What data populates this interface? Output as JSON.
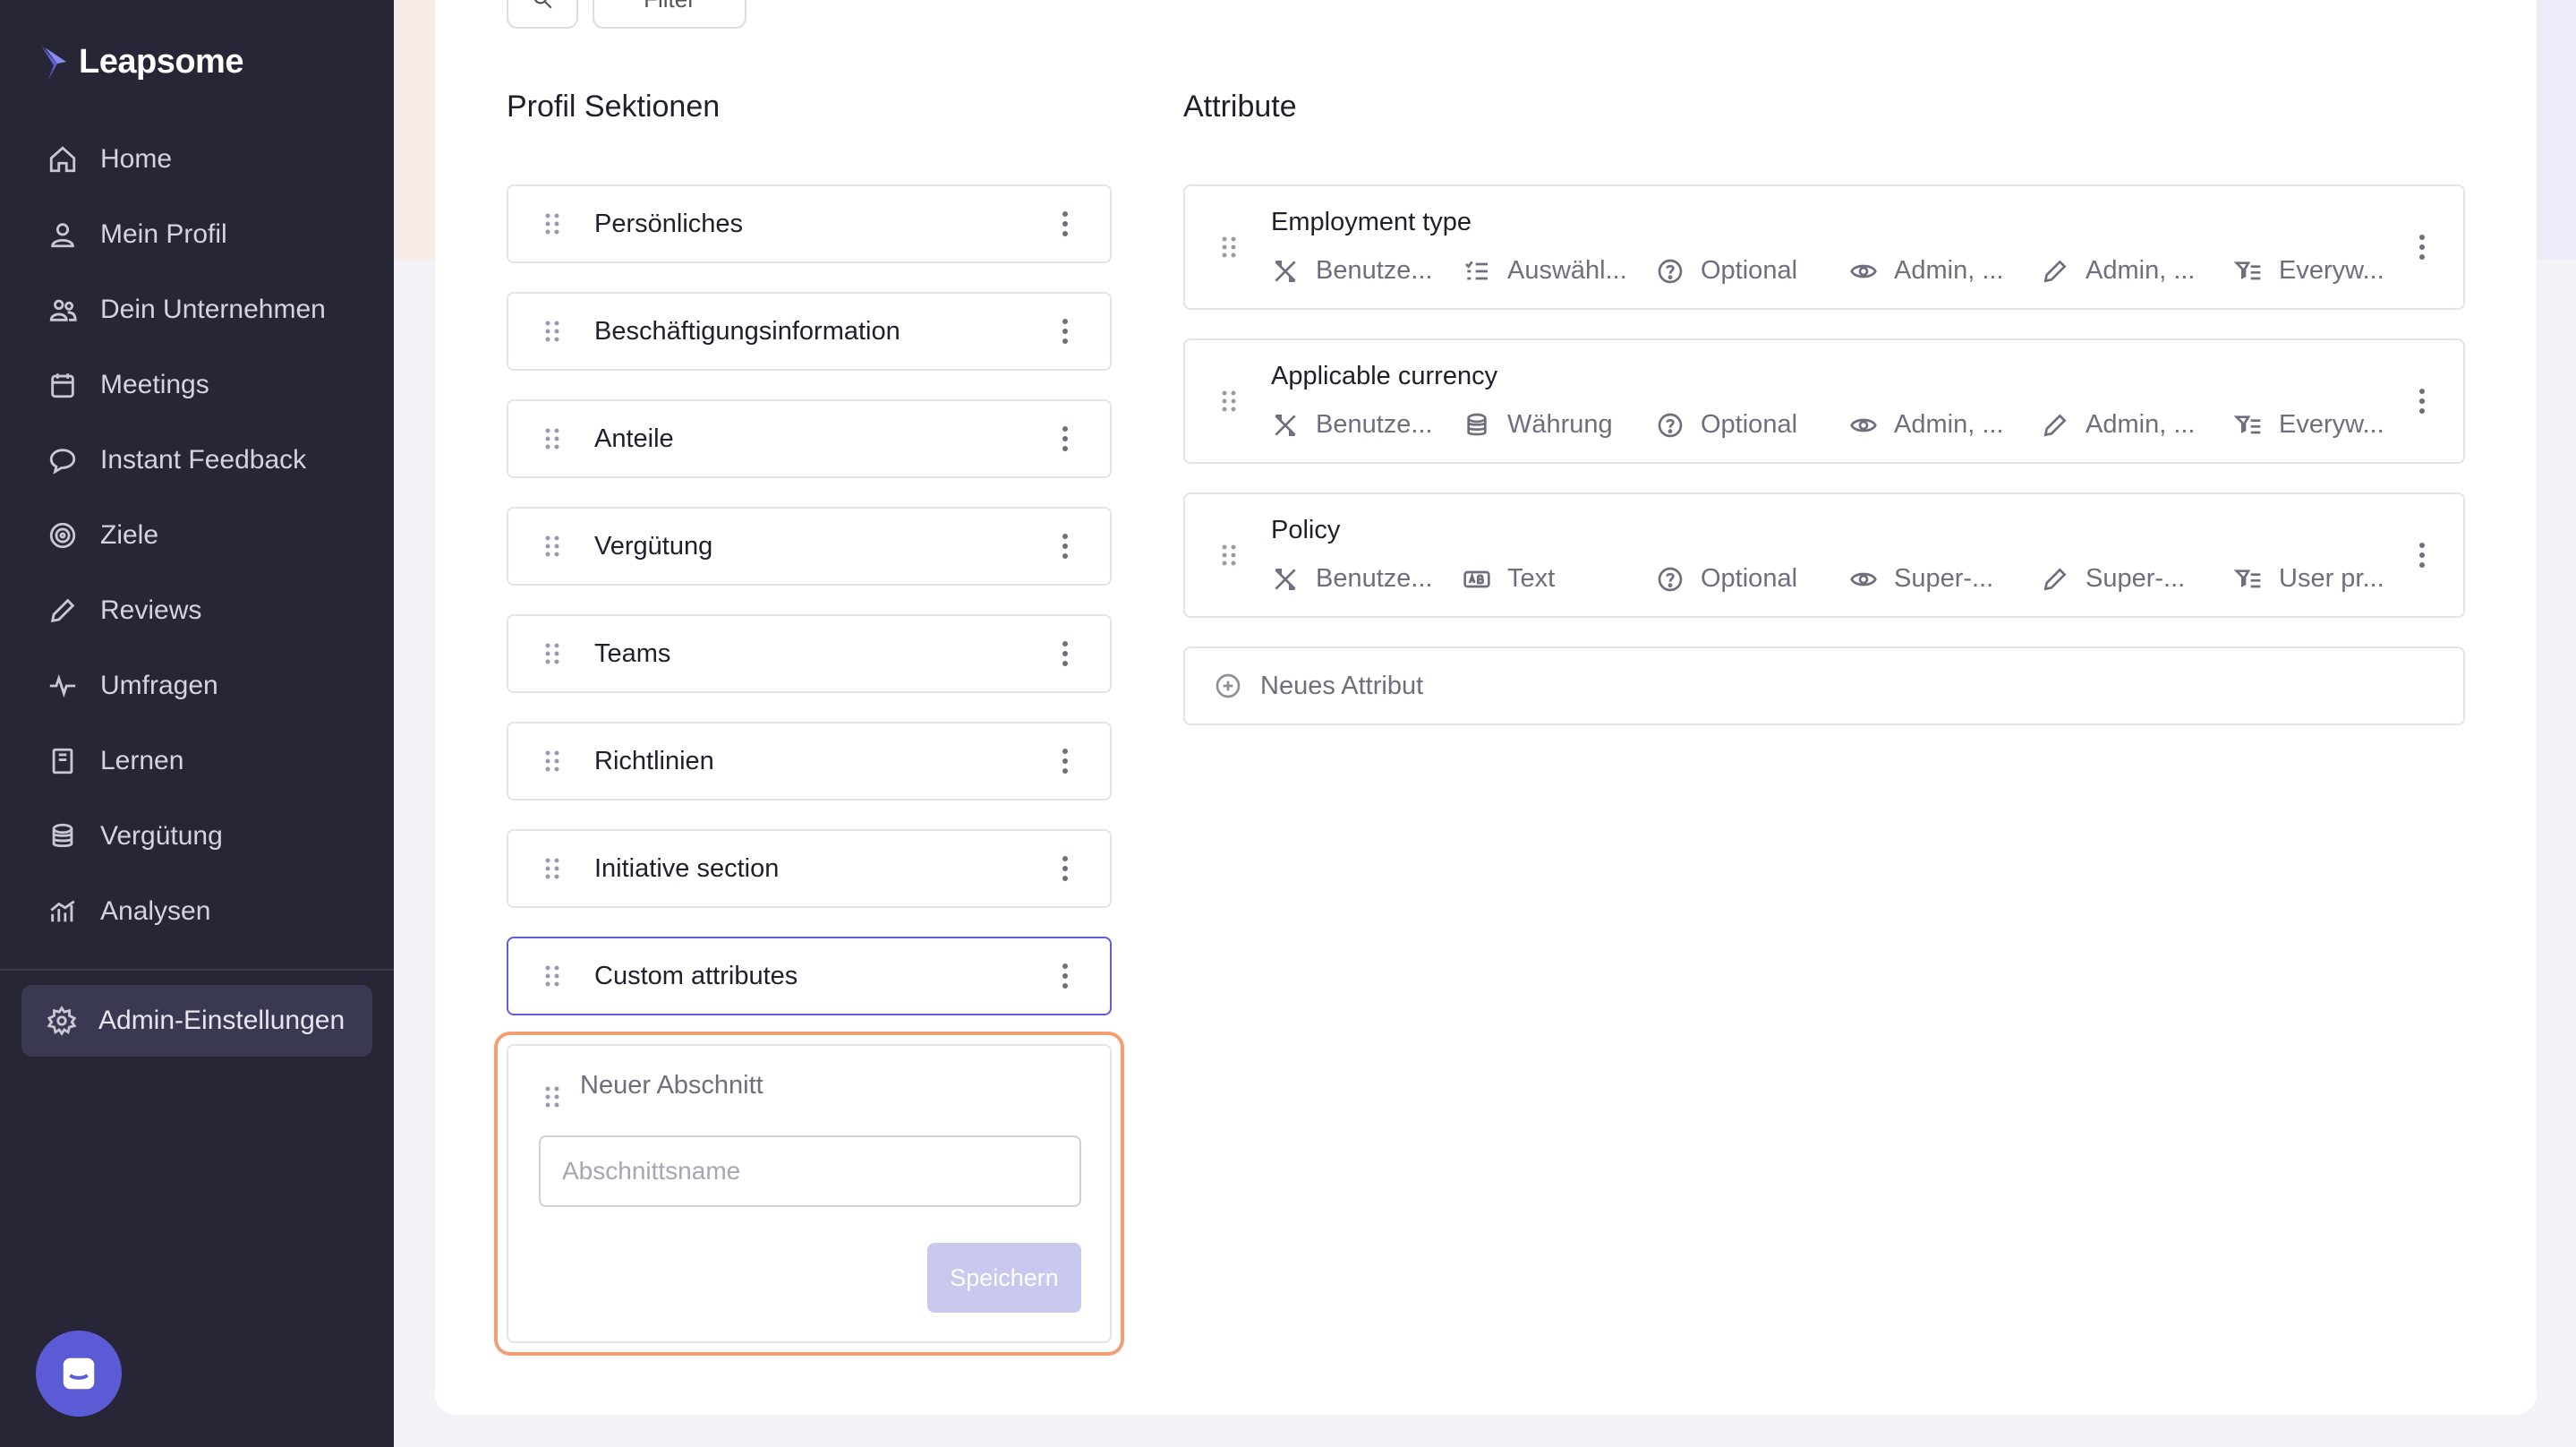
{
  "app": {
    "logo_text": "Leapsome"
  },
  "sidebar": {
    "items": [
      {
        "label": "Home",
        "icon": "home-icon"
      },
      {
        "label": "Mein Profil",
        "icon": "user-icon"
      },
      {
        "label": "Dein Unternehmen",
        "icon": "users-icon"
      },
      {
        "label": "Meetings",
        "icon": "calendar-icon"
      },
      {
        "label": "Instant Feedback",
        "icon": "chat-bubble-icon"
      },
      {
        "label": "Ziele",
        "icon": "target-icon"
      },
      {
        "label": "Reviews",
        "icon": "pencil-icon"
      },
      {
        "label": "Umfragen",
        "icon": "pulse-icon"
      },
      {
        "label": "Lernen",
        "icon": "book-icon"
      },
      {
        "label": "Vergütung",
        "icon": "coins-icon"
      },
      {
        "label": "Analysen",
        "icon": "chart-icon"
      }
    ],
    "admin": {
      "label": "Admin-Einstellungen",
      "icon": "gear-icon"
    }
  },
  "toolbar": {
    "filter_label": "Filter"
  },
  "sections": {
    "title": "Profil Sektionen",
    "items": [
      {
        "label": "Persönliches"
      },
      {
        "label": "Beschäftigungsinformation"
      },
      {
        "label": "Anteile"
      },
      {
        "label": "Vergütung"
      },
      {
        "label": "Teams"
      },
      {
        "label": "Richtlinien"
      },
      {
        "label": "Initiative section"
      },
      {
        "label": "Custom attributes",
        "selected": true
      }
    ],
    "new_section": {
      "title": "Neuer Abschnitt",
      "input_placeholder": "Abschnittsname",
      "input_value": "",
      "save_label": "Speichern"
    }
  },
  "attributes": {
    "title": "Attribute",
    "items": [
      {
        "name": "Employment type",
        "source": "Benutze...",
        "type": "Auswähl...",
        "type_icon": "list-icon",
        "required": "Optional",
        "visibility": "Admin, ...",
        "edit": "Admin, ...",
        "scope": "Everyw..."
      },
      {
        "name": "Applicable currency",
        "source": "Benutze...",
        "type": "Währung",
        "type_icon": "coins-icon",
        "required": "Optional",
        "visibility": "Admin, ...",
        "edit": "Admin, ...",
        "scope": "Everyw..."
      },
      {
        "name": "Policy",
        "source": "Benutze...",
        "type": "Text",
        "type_icon": "text-icon",
        "required": "Optional",
        "visibility": "Super-...",
        "edit": "Super-...",
        "scope": "User pr..."
      }
    ],
    "new_label": "Neues Attribut"
  },
  "colors": {
    "sidebar_bg": "#262636",
    "accent": "#5e5ed6",
    "highlight": "#f0a072"
  }
}
